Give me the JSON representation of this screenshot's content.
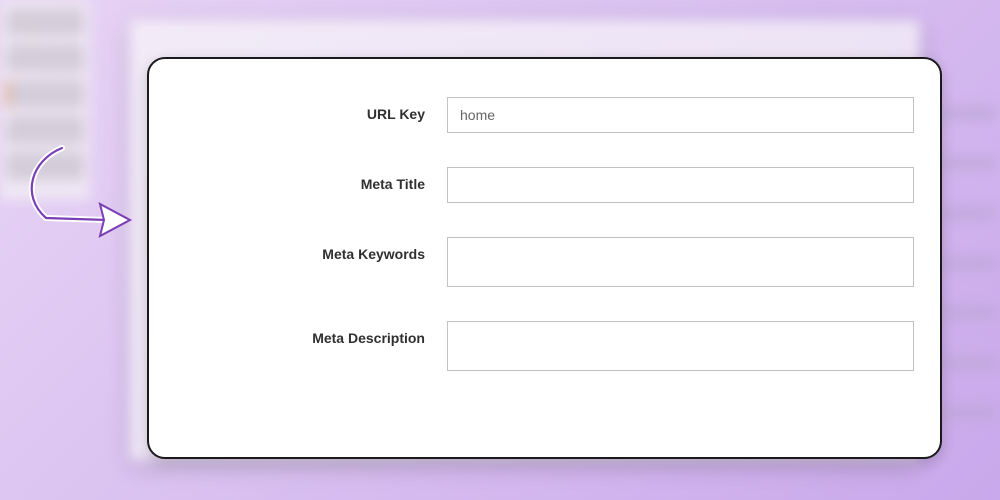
{
  "form": {
    "url_key": {
      "label": "URL Key",
      "value": "home"
    },
    "meta_title": {
      "label": "Meta Title",
      "value": ""
    },
    "meta_keywords": {
      "label": "Meta Keywords",
      "value": ""
    },
    "meta_description": {
      "label": "Meta Description",
      "value": ""
    }
  }
}
